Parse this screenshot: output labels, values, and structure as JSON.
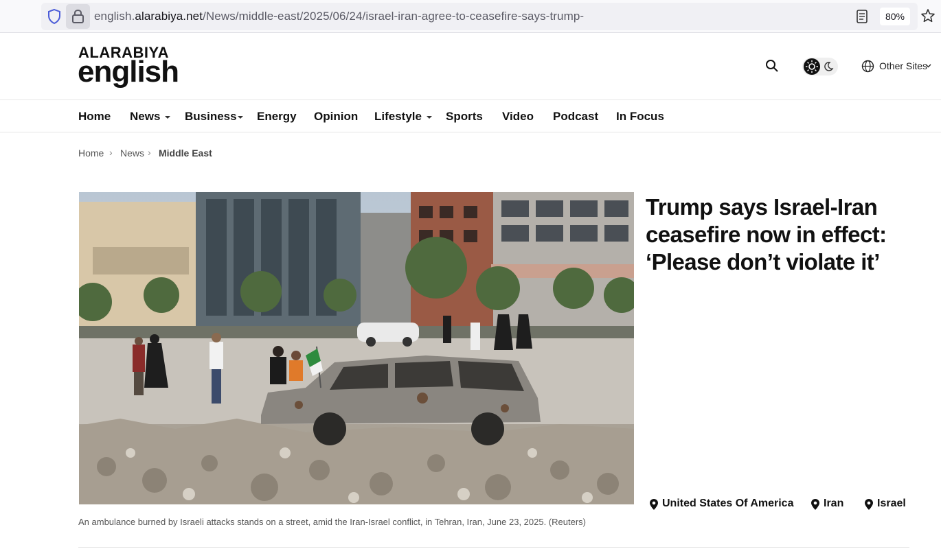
{
  "browser": {
    "url_prefix": "english.",
    "url_domain": "alarabiya.net",
    "url_path": "/News/middle-east/2025/06/24/israel-iran-agree-to-ceasefire-says-trump-",
    "zoom": "80%",
    "icons": [
      "shield-icon",
      "lock-icon",
      "reader-view-icon",
      "star-icon"
    ]
  },
  "site": {
    "logo_top": "ALARABIYA",
    "logo_main": "english",
    "other_sites_label": "Other Sites",
    "icons": [
      "search-icon",
      "sun-icon",
      "moon-icon",
      "globe-icon",
      "chevron-down-icon"
    ]
  },
  "nav": {
    "items": [
      {
        "label": "Home"
      },
      {
        "label": "News"
      },
      {
        "label": "Business"
      },
      {
        "label": "Energy"
      },
      {
        "label": "Opinion"
      },
      {
        "label": "Lifestyle"
      },
      {
        "label": "Sports"
      },
      {
        "label": "Video"
      },
      {
        "label": "Podcast"
      },
      {
        "label": "In Focus"
      }
    ]
  },
  "breadcrumb": {
    "items": [
      "Home",
      "News",
      "Middle East"
    ],
    "separator": "›"
  },
  "article": {
    "headline": "Trump says Israel-Iran ceasefire now in effect: ‘Please don’t violate it’",
    "caption": "An ambulance burned by Israeli attacks stands on a street, amid the Iran-Israel conflict, in Tehran, Iran, June 23, 2025. (Reuters)",
    "tags": [
      "United States Of America",
      "Iran",
      "Israel"
    ]
  },
  "colors": {
    "text": "#111111",
    "url_muted": "#5b5b66",
    "chrome_bg": "#f9f9fb"
  }
}
